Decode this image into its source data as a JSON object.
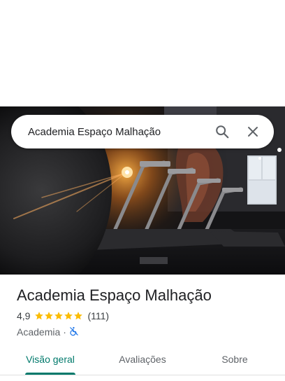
{
  "search": {
    "query": "Academia Espaço Malhação",
    "search_icon": "search-icon",
    "close_icon": "close-icon"
  },
  "place": {
    "name": "Academia Espaço Malhação",
    "rating": "4,9",
    "stars": 5,
    "reviews": "(111)",
    "category": "Academia",
    "separator": "·",
    "accessibility_icon": "wheelchair-not-accessible-icon"
  },
  "tabs": [
    {
      "label": "Visão geral",
      "active": true
    },
    {
      "label": "Avaliações",
      "active": false
    },
    {
      "label": "Sobre",
      "active": false
    }
  ],
  "colors": {
    "accent": "#00796b",
    "star": "#fbbc04",
    "accessibility": "#1a73e8"
  }
}
